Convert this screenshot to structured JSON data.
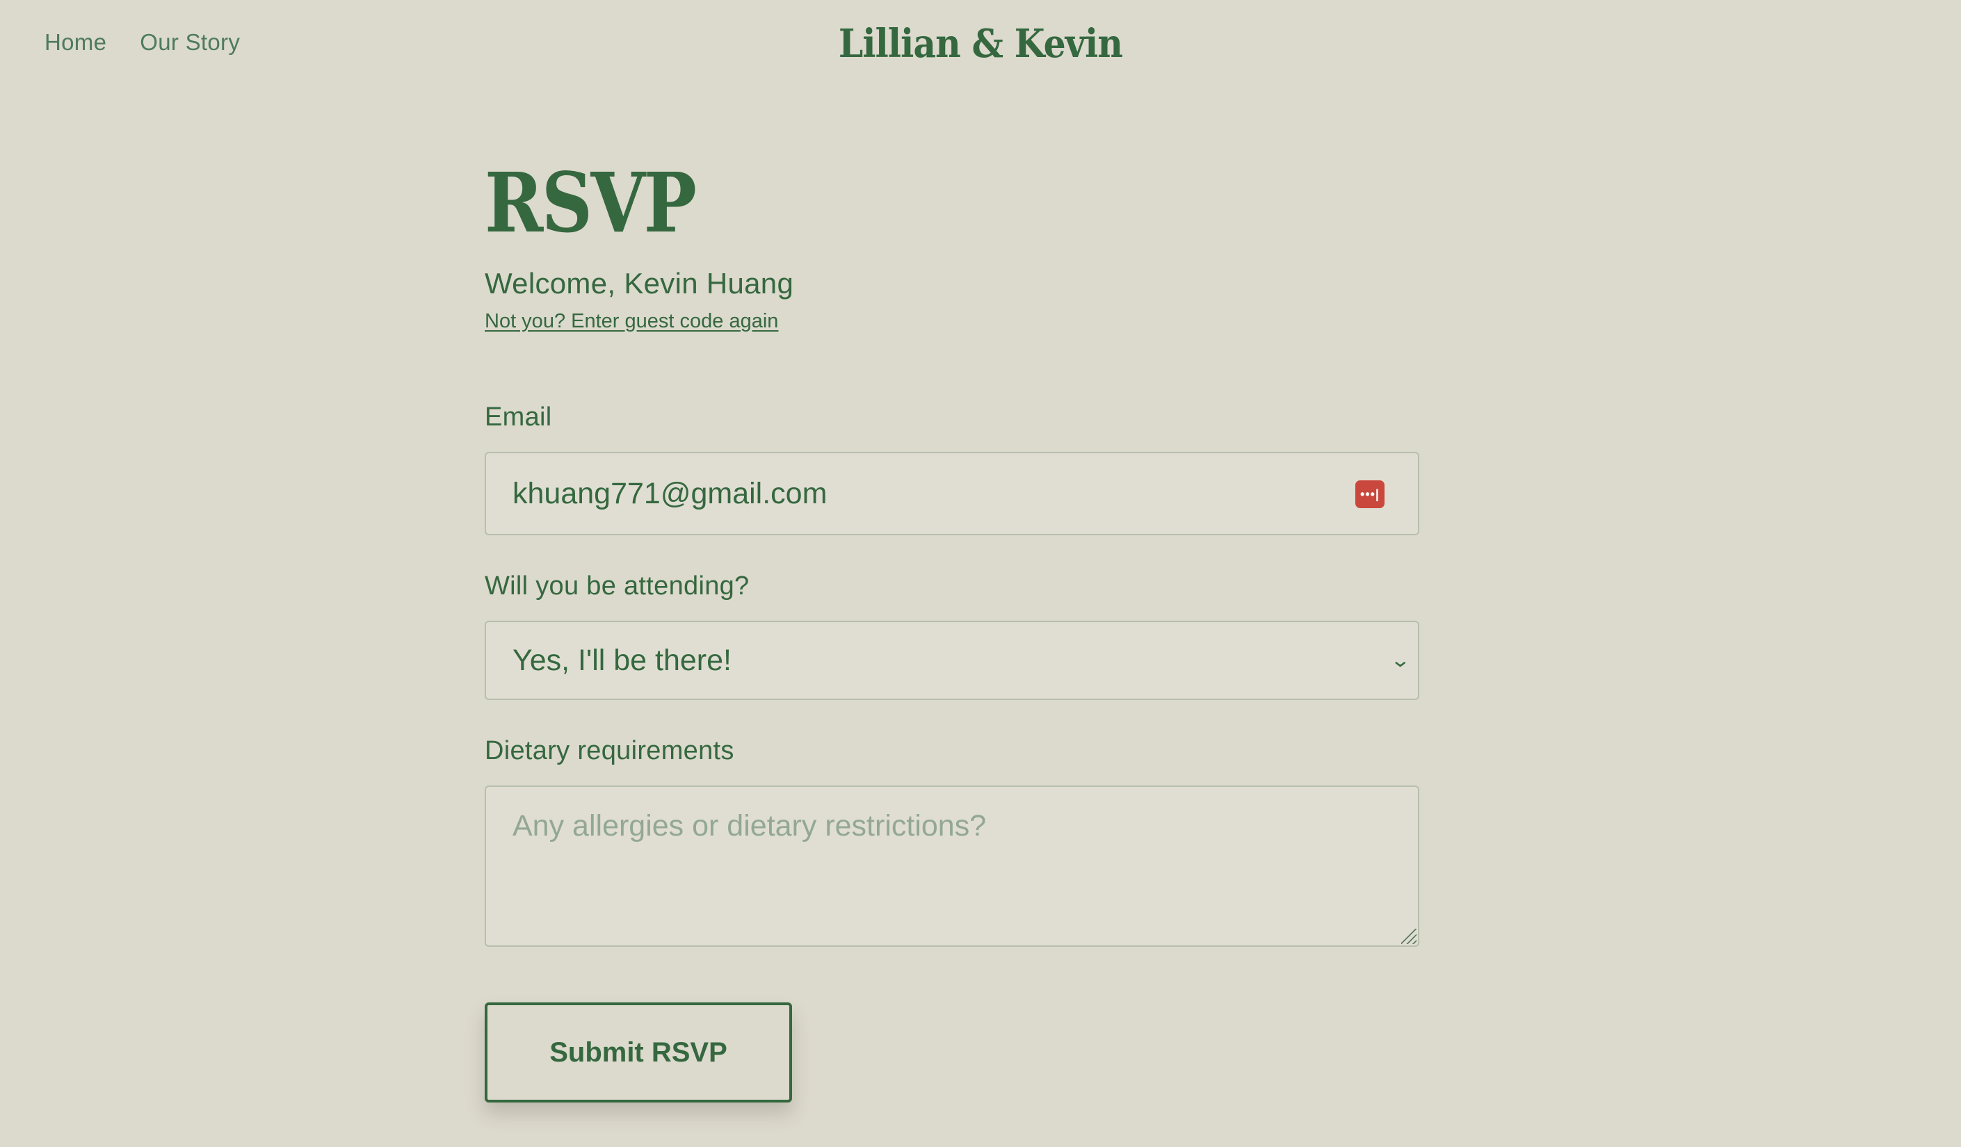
{
  "nav": {
    "items": [
      {
        "label": "Home"
      },
      {
        "label": "Our Story"
      }
    ],
    "brand": "Lillian & Kevin"
  },
  "page": {
    "title": "RSVP",
    "welcome": "Welcome, Kevin Huang",
    "not_you_link": "Not you? Enter guest code again"
  },
  "form": {
    "email_label": "Email",
    "email_value": "khuang771@gmail.com",
    "attending_label": "Will you be attending?",
    "attending_value": "Yes, I'll be there!",
    "dietary_label": "Dietary requirements",
    "dietary_placeholder": "Any allergies or dietary restrictions?",
    "submit_label": "Submit RSVP"
  },
  "icons": {
    "password_manager": "password-manager-icon",
    "dropdown": "chevron-down-icon"
  },
  "colors": {
    "background": "#dcd9cd",
    "accent": "#35683f",
    "password_manager": "#c9473c"
  }
}
